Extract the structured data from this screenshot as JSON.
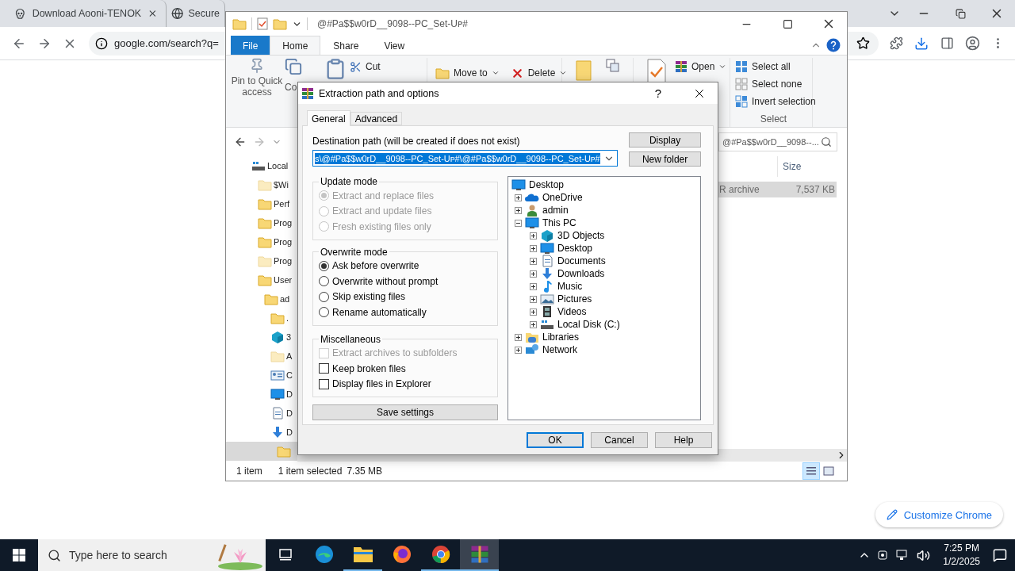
{
  "browser": {
    "tabs": [
      {
        "title": "Download Aooni-TENOK",
        "selected": false
      },
      {
        "title": "Secure",
        "selected": false
      }
    ],
    "address": "google.com/search?q=",
    "customize_button": "Customize Chrome"
  },
  "explorer": {
    "title": "@#Pa$$w0rD__9098--PC_Set-Uᴘ#",
    "ribbon_tabs": [
      {
        "label": "File",
        "selected": false
      },
      {
        "label": "Home",
        "selected": true
      },
      {
        "label": "Share",
        "selected": false
      },
      {
        "label": "View",
        "selected": false
      }
    ],
    "ribbon": {
      "pin": "Pin to Quick access",
      "copy": "Co",
      "cut": "Cut",
      "move_to": "Move to",
      "delete": "Delete",
      "open": "Open",
      "select_all": "Select all",
      "select_none": "Select none",
      "invert_selection": "Invert selection",
      "select_group": "Select"
    },
    "search": {
      "placeholder": "@#Pa$$w0rD__9098--..."
    },
    "nav_tree": [
      {
        "label": "Local",
        "hidden": false,
        "selected": false,
        "children": [
          {
            "label": "$Wi",
            "hidden": true,
            "selected": false
          },
          {
            "label": "Perf",
            "hidden": false,
            "selected": false
          },
          {
            "label": "Prog",
            "hidden": false,
            "selected": false
          },
          {
            "label": "Prog",
            "hidden": false,
            "selected": false
          },
          {
            "label": "Prog",
            "hidden": true,
            "selected": false
          },
          {
            "label": "User",
            "hidden": false,
            "selected": false,
            "children": [
              {
                "label": "ad",
                "hidden": false,
                "selected": false,
                "children": [
                  {
                    "label": ".",
                    "hidden": false,
                    "selected": false
                  },
                  {
                    "label": "3",
                    "hidden": false,
                    "selected": false
                  },
                  {
                    "label": "A",
                    "hidden": true,
                    "selected": false
                  },
                  {
                    "label": "C",
                    "hidden": false,
                    "selected": false
                  },
                  {
                    "label": "D",
                    "hidden": false,
                    "selected": false
                  },
                  {
                    "label": "D",
                    "hidden": false,
                    "selected": false
                  },
                  {
                    "label": "D",
                    "hidden": false,
                    "selected": false,
                    "children": [
                      {
                        "hidden": false,
                        "selected": true
                      }
                    ]
                  }
                ]
              }
            ]
          }
        ]
      }
    ],
    "columns": [
      "Size"
    ],
    "rows": [
      {
        "cells": [
          "R archive",
          "7,537 KB"
        ],
        "selected": true
      }
    ],
    "status": [
      "1 item",
      "1 item selected",
      "7.35 MB"
    ]
  },
  "dialog": {
    "title": "Extraction path and options",
    "help": "?",
    "tabs": [
      {
        "label": "General",
        "selected": true
      },
      {
        "label": "Advanced",
        "selected": false
      }
    ],
    "destination_label": "Destination path (will be created if does not exist)",
    "destination_value": "s\\@#Pa$$w0rD__9098--PC_Set-Uᴘ#\\@#Pa$$w0rD__9098--PC_Set-Uᴘ#",
    "side_buttons": [
      "Display",
      "New folder"
    ],
    "update_mode": {
      "title": "Update mode",
      "options": [
        {
          "label": "Extract and replace files",
          "selected": true,
          "disabled": true
        },
        {
          "label": "Extract and update files",
          "selected": false,
          "disabled": true
        },
        {
          "label": "Fresh existing files only",
          "selected": false,
          "disabled": true
        }
      ]
    },
    "overwrite_mode": {
      "title": "Overwrite mode",
      "options": [
        {
          "label": "Ask before overwrite",
          "selected": true,
          "disabled": false
        },
        {
          "label": "Overwrite without prompt",
          "selected": false,
          "disabled": false
        },
        {
          "label": "Skip existing files",
          "selected": false,
          "disabled": false
        },
        {
          "label": "Rename automatically",
          "selected": false,
          "disabled": false
        }
      ]
    },
    "miscellaneous": {
      "title": "Miscellaneous",
      "options": [
        {
          "label": "Extract archives to subfolders",
          "checked": false,
          "disabled": true
        },
        {
          "label": "Keep broken files",
          "checked": false,
          "disabled": false
        },
        {
          "label": "Display files in Explorer",
          "checked": false,
          "disabled": false
        }
      ]
    },
    "save_button": "Save settings",
    "folder_tree": [
      {
        "label": "Desktop",
        "children": [
          {
            "label": "OneDrive",
            "expanded": false
          },
          {
            "label": "admin",
            "expanded": false
          },
          {
            "label": "This PC",
            "expanded": true,
            "children": [
              {
                "label": "3D Objects",
                "expanded": false
              },
              {
                "label": "Desktop",
                "expanded": false
              },
              {
                "label": "Documents",
                "expanded": false
              },
              {
                "label": "Downloads",
                "expanded": false
              },
              {
                "label": "Music",
                "expanded": false
              },
              {
                "label": "Pictures",
                "expanded": false
              },
              {
                "label": "Videos",
                "expanded": false
              },
              {
                "label": "Local Disk (C:)",
                "expanded": false
              }
            ]
          },
          {
            "label": "Libraries",
            "expanded": false
          },
          {
            "label": "Network",
            "expanded": false
          }
        ]
      }
    ],
    "buttons": [
      {
        "label": "OK",
        "default": true
      },
      {
        "label": "Cancel",
        "default": false
      },
      {
        "label": "Help",
        "default": false
      }
    ]
  },
  "taskbar": {
    "search_placeholder": "Type here to search",
    "apps": [
      {
        "running": false,
        "active": false
      },
      {
        "running": false,
        "active": false
      },
      {
        "running": true,
        "active": false
      },
      {
        "running": false,
        "active": false
      },
      {
        "running": true,
        "active": false
      },
      {
        "running": true,
        "active": true
      }
    ],
    "time": "7:25 PM",
    "date": "1/2/2025"
  }
}
